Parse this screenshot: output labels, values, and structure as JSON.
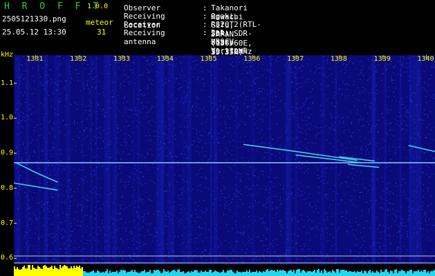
{
  "header": {
    "app_title": "H R O F F T",
    "app_version": "1.0.0",
    "file_name": "2505121330.png",
    "meteor_label": "meteor",
    "timestamp": "25.05.12 13:30",
    "meteor_count": "31"
  },
  "station_info": [
    {
      "label": "Observer",
      "value": "Takanori Kawachi"
    },
    {
      "label": "Receiving Location",
      "value": "Ogaki, Gifu, JAPAN (136.60E, 35.35N)"
    },
    {
      "label": "Receiver",
      "value": "R820T2(RTL-SDR) SDR-Sharp 53.372MHz"
    },
    {
      "label": "Receiving antenna",
      "value": "2el-HB9CV Vertical (el. E-W)"
    }
  ],
  "separator": ":",
  "spectrogram": {
    "unit_label": "kHz",
    "x_ticks": [
      "1331",
      "1332",
      "1333",
      "1334",
      "1335",
      "1336",
      "1337",
      "1338",
      "1339",
      "1340"
    ],
    "y_ticks": [
      "1.1",
      "1.0",
      "0.9",
      "0.8",
      "0.7",
      "0.6"
    ],
    "x_range": [
      1330.5,
      1340.2
    ],
    "y_range": [
      0.583,
      1.18
    ],
    "carrier_khz": 0.873,
    "echoes": [
      {
        "from": [
          1330.55,
          0.873
        ],
        "to": [
          1331.0,
          0.845
        ],
        "then": [
          1331.5,
          0.818
        ]
      },
      {
        "from": [
          1330.5,
          0.815
        ],
        "to": [
          1331.5,
          0.795
        ]
      },
      {
        "from": [
          1335.8,
          0.925
        ],
        "to": [
          1337.0,
          0.905
        ],
        "then": [
          1338.4,
          0.88
        ]
      },
      {
        "from": [
          1337.0,
          0.895
        ],
        "to": [
          1338.5,
          0.873
        ]
      },
      {
        "from": [
          1338.0,
          0.89
        ],
        "to": [
          1338.8,
          0.878
        ]
      },
      {
        "from": [
          1339.6,
          0.922
        ],
        "to": [
          1340.2,
          0.905
        ]
      },
      {
        "from": [
          1338.2,
          0.868
        ],
        "to": [
          1338.9,
          0.86
        ]
      }
    ],
    "colors": {
      "background": "#0a0a78",
      "noise": "#2a3cf0",
      "signal": "#4ff0ff",
      "carrier": "#8fd0ff",
      "level_strong": "#ffff00",
      "level_base": "#1fd8f0",
      "reference_line": "#c8c8c8"
    }
  }
}
